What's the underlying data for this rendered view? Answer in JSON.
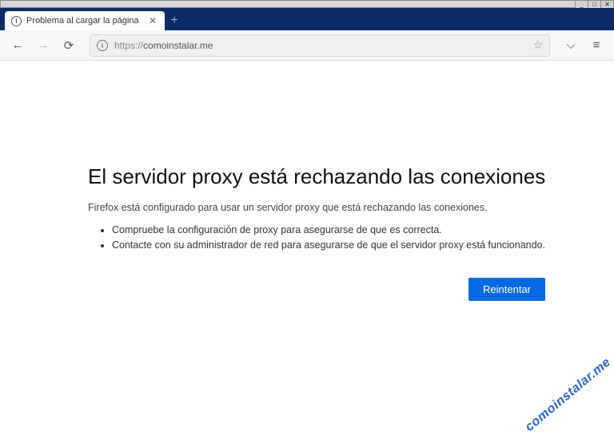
{
  "window": {
    "minimize": "_",
    "maximize": "□",
    "close": "✕"
  },
  "tab": {
    "title": "Problema al cargar la página",
    "close": "✕"
  },
  "newtab_glyph": "+",
  "nav": {
    "back": "←",
    "forward": "→",
    "reload": "⟳"
  },
  "urlbar": {
    "info_glyph": "i",
    "protocol": "https://",
    "host": "comoinstalar.me",
    "star": "☆"
  },
  "toolbar_right": {
    "pocket": "⌵",
    "menu": "≡"
  },
  "error": {
    "heading": "El servidor proxy está rechazando las conexiones",
    "description": "Firefox está configurado para usar un servidor proxy que está rechazando las conexiones.",
    "bullets": [
      "Compruebe la configuración de proxy para asegurarse de que es correcta.",
      "Contacte con su administrador de red para asegurarse de que el servidor proxy está funcionando."
    ],
    "retry_label": "Reintentar"
  },
  "watermark": "comoinstalar.me"
}
